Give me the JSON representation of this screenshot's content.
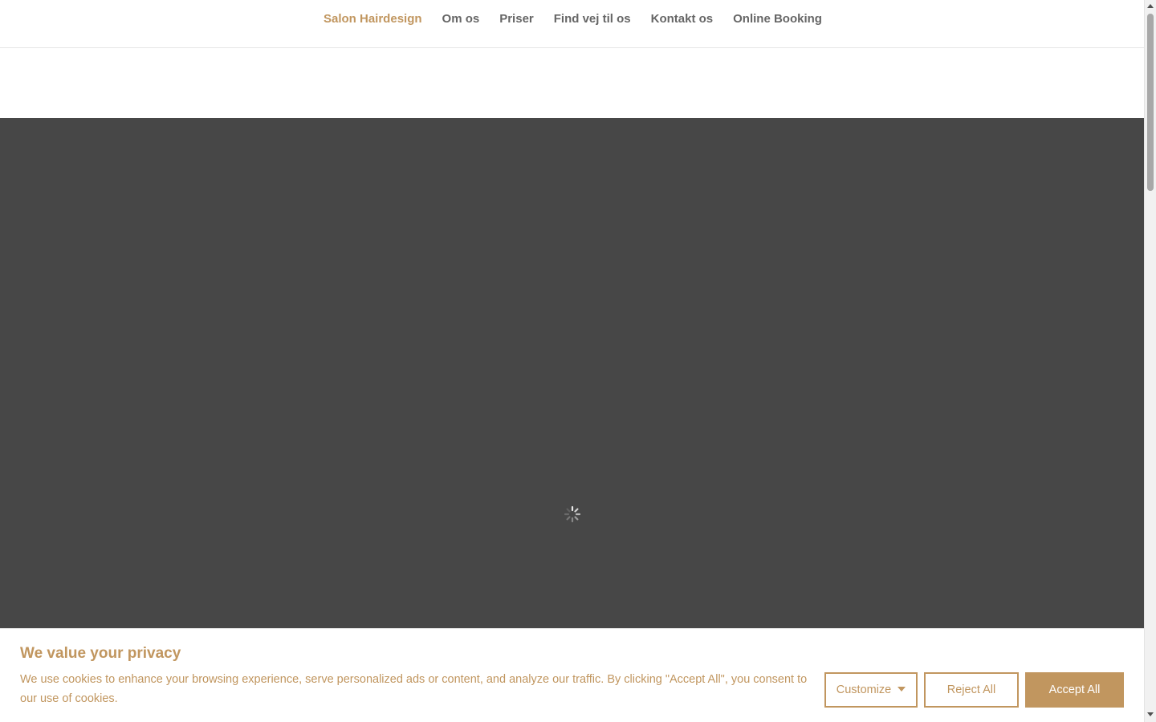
{
  "nav": {
    "items": [
      {
        "label": "Salon Hairdesign",
        "active": true
      },
      {
        "label": "Om os",
        "active": false
      },
      {
        "label": "Priser",
        "active": false
      },
      {
        "label": "Find vej til os",
        "active": false
      },
      {
        "label": "Kontakt os",
        "active": false
      },
      {
        "label": "Online Booking",
        "active": false
      }
    ]
  },
  "hero": {
    "background": "#474747",
    "loading_icon": "spinner-icon"
  },
  "cookie": {
    "title": "We value your privacy",
    "text": "We use cookies to enhance your browsing experience, serve personalized ads or content, and analyze our traffic. By clicking \"Accept All\", you consent to our use of cookies.",
    "customize_label": "Customize",
    "reject_label": "Reject All",
    "accept_label": "Accept All"
  },
  "colors": {
    "accent": "#c1965f",
    "nav_text": "#666666",
    "hero_bg": "#474747"
  }
}
